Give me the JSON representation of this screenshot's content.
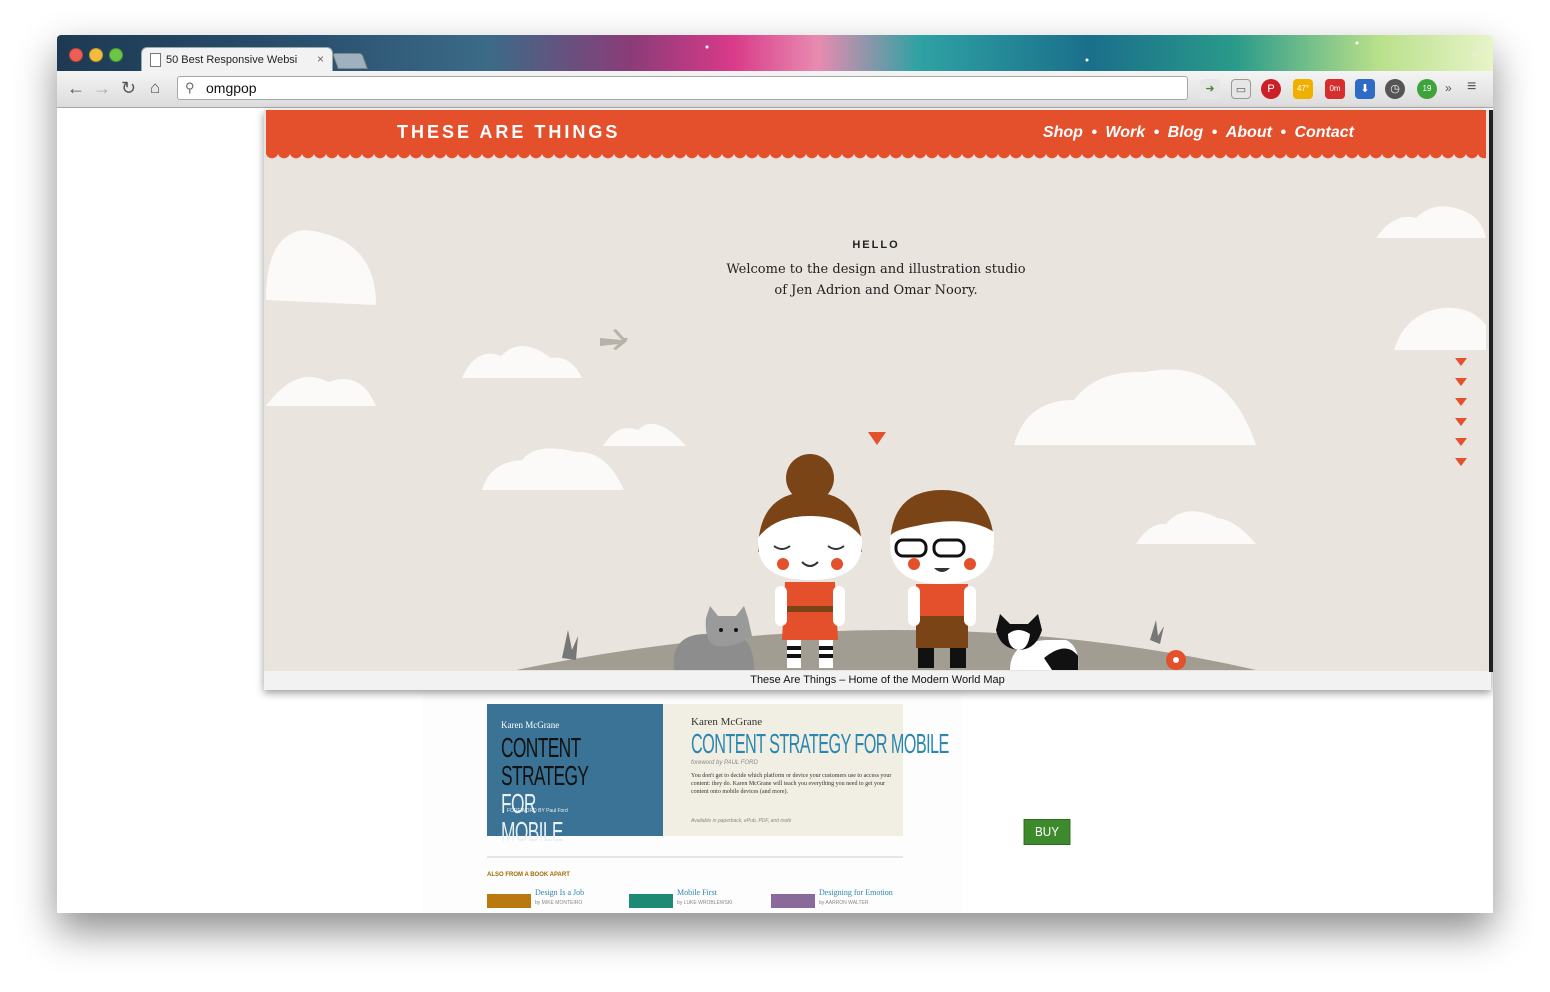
{
  "browser": {
    "tab_title": "50 Best Responsive Websi",
    "tab_close": "×",
    "address_value": "omgpop",
    "ext_badges": [
      "47°",
      "0m",
      "19"
    ],
    "overflow_label": "»"
  },
  "site": {
    "logo": "THESE ARE THINGS",
    "nav": [
      "Shop",
      "Work",
      "Blog",
      "About",
      "Contact"
    ],
    "nav_separator": "•",
    "hello": "HELLO",
    "welcome_line1": "Welcome to the design and illustration studio",
    "welcome_line2": "of Jen Adrion and Omar Noory.",
    "caption": "These Are Things – Home of the Modern World Map"
  },
  "bookad": {
    "cover_author": "Karen McGrane",
    "cover_title_line1": "CONTENT STRATEGY",
    "cover_title_line2": "FOR MOBILE",
    "cover_foreword": "FOREWORD BY Paul Ford",
    "info_author": "Karen McGrane",
    "info_title": "CONTENT STRATEGY FOR MOBILE",
    "info_foreword": "foreword by PAUL FORD",
    "info_desc": "You don't get to decide which platform or device your customers use to access your content: they do. Karen McGrane will teach you everything you need to get your content onto mobile devices (and more).",
    "info_available": "Available in paperback, ePub, PDF, and mobi",
    "buy_now": "BUY NOW",
    "also_heading": "ALSO FROM A BOOK APART",
    "also_books": [
      {
        "title": "Design Is a Job",
        "author": "by MIKE MONTEIRO",
        "color": "#b9790e"
      },
      {
        "title": "Mobile First",
        "author": "by LUKE WROBLEWSKI",
        "color": "#1f8a73"
      },
      {
        "title": "Designing for Emotion",
        "author": "by AARRON WALTER",
        "color": "#8a6a9a"
      }
    ]
  }
}
